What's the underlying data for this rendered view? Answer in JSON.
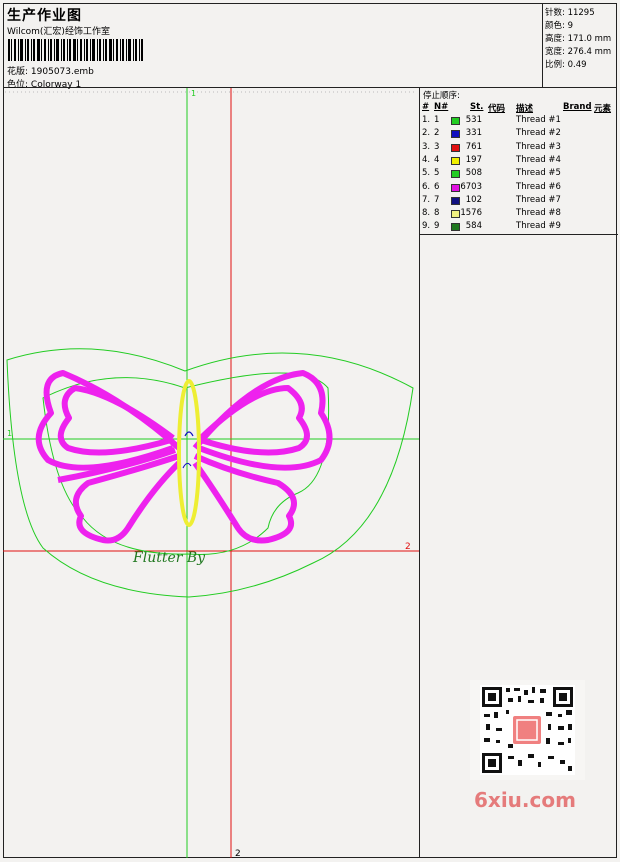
{
  "header": {
    "title": "生产作业图",
    "studio": "Wilcom(汇宏)经饰工作室",
    "design_label": "花版:",
    "design_value": "1905073.emb",
    "colorway_label": "色位:",
    "colorway_value": "Colorway 1"
  },
  "stats": {
    "stitches_label": "针数:",
    "stitches_value": "11295",
    "colors_label": "颜色:",
    "colors_value": "9",
    "height_label": "高度:",
    "height_value": "171.0 mm",
    "width_label": "宽度:",
    "width_value": "276.4 mm",
    "scale_label": "比例:",
    "scale_value": "0.49"
  },
  "stop_sequence": {
    "title": "停止顺序:",
    "headers": {
      "num": "#",
      "needle": "N#",
      "st": "St.",
      "code": "代码",
      "desc": "描述",
      "brand": "Brand",
      "element": "元素"
    },
    "rows": [
      {
        "num": "1.",
        "needle": "1",
        "color": "#22cc22",
        "code": "531",
        "desc": "Thread #1"
      },
      {
        "num": "2.",
        "needle": "2",
        "color": "#1010c0",
        "code": "331",
        "desc": "Thread #2"
      },
      {
        "num": "3.",
        "needle": "3",
        "color": "#e01010",
        "code": "761",
        "desc": "Thread #3"
      },
      {
        "num": "4.",
        "needle": "4",
        "color": "#f0f000",
        "code": "197",
        "desc": "Thread #4"
      },
      {
        "num": "5.",
        "needle": "5",
        "color": "#22cc22",
        "code": "508",
        "desc": "Thread #5"
      },
      {
        "num": "6.",
        "needle": "6",
        "color": "#e010e0",
        "code": "6703",
        "desc": "Thread #6"
      },
      {
        "num": "7.",
        "needle": "7",
        "color": "#101080",
        "code": "102",
        "desc": "Thread #7"
      },
      {
        "num": "8.",
        "needle": "8",
        "color": "#f0f080",
        "code": "1576",
        "desc": "Thread #8"
      },
      {
        "num": "9.",
        "needle": "9",
        "color": "#207820",
        "code": "584",
        "desc": "Thread #9"
      }
    ]
  },
  "canvas": {
    "guide_v1": "1",
    "guide_h1": "1",
    "guide_v2": "2",
    "guide_h2": "2",
    "signature": "Flutter By"
  },
  "watermark": {
    "site": "6xiu.com"
  },
  "colors": {
    "butterfly": "#ee22ee",
    "body": "#eeee33",
    "outline": "#22cc22",
    "guide_green": "#22cc22",
    "guide_red": "#e01010"
  }
}
